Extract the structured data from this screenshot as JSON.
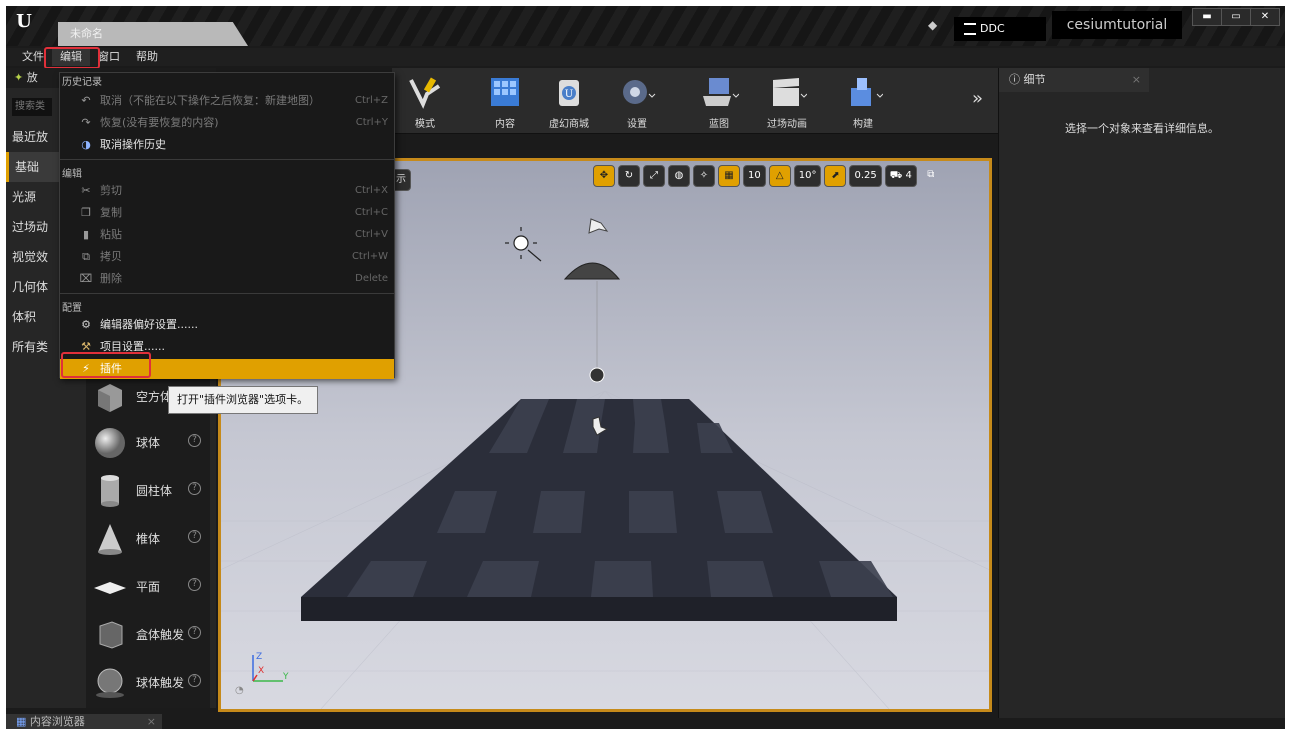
{
  "window": {
    "doc_tab": "未命名",
    "ddc_label": "DDC",
    "project_name": "cesiumtutorial",
    "window_buttons": [
      "▬",
      "▭",
      "✕"
    ]
  },
  "menubar": {
    "items": [
      "文件",
      "编辑",
      "窗口",
      "帮助"
    ]
  },
  "modes": {
    "header": "放",
    "search_placeholder": "搜索类",
    "categories": [
      "最近放",
      "基础",
      "光源",
      "过场动",
      "视觉效",
      "几何体",
      "体积",
      "所有类"
    ],
    "places": [
      {
        "label": "空方体",
        "icon": "cube-icon"
      },
      {
        "label": "球体",
        "icon": "sphere-icon"
      },
      {
        "label": "圆柱体",
        "icon": "cylinder-icon"
      },
      {
        "label": "椎体",
        "icon": "cone-icon"
      },
      {
        "label": "平面",
        "icon": "plane-icon"
      },
      {
        "label": "盒体触发",
        "icon": "box-trigger-icon"
      },
      {
        "label": "球体触发",
        "icon": "sphere-trigger-icon"
      }
    ],
    "help_glyph": "?"
  },
  "toolbar": {
    "items": [
      {
        "label": "模式",
        "icon": "modes-icon"
      },
      {
        "label": "内容",
        "icon": "content-icon"
      },
      {
        "label": "虚幻商城",
        "icon": "marketplace-icon"
      },
      {
        "label": "设置",
        "icon": "settings-icon"
      },
      {
        "label": "蓝图",
        "icon": "blueprint-icon"
      },
      {
        "label": "过场动画",
        "icon": "cinematics-icon"
      },
      {
        "label": "构建",
        "icon": "build-icon"
      }
    ],
    "more": "»"
  },
  "viewport": {
    "show_label": "示",
    "grid_snap": "10",
    "rotation_snap": "10°",
    "scale_snap": "0.25",
    "camera_speed": "4",
    "axis_z": "Z",
    "axis_x": "X",
    "axis_y": "Y"
  },
  "details": {
    "tab_label": "细节",
    "hint": "选择一个对象来查看详细信息。"
  },
  "content_browser": {
    "tab_label": "内容浏览器"
  },
  "edit_menu": {
    "sections": {
      "history": "历史记录",
      "edit": "编辑",
      "config": "配置"
    },
    "history_items": [
      {
        "label": "取消（不能在以下操作之后恢复：新建地图）",
        "shortcut": "Ctrl+Z",
        "disabled": true
      },
      {
        "label": "恢复(没有要恢复的内容)",
        "shortcut": "Ctrl+Y",
        "disabled": true
      },
      {
        "label": "取消操作历史",
        "shortcut": "",
        "disabled": false
      }
    ],
    "edit_items": [
      {
        "label": "剪切",
        "shortcut": "Ctrl+X"
      },
      {
        "label": "复制",
        "shortcut": "Ctrl+C"
      },
      {
        "label": "粘贴",
        "shortcut": "Ctrl+V"
      },
      {
        "label": "拷贝",
        "shortcut": "Ctrl+W"
      },
      {
        "label": "删除",
        "shortcut": "Delete"
      }
    ],
    "config_items": [
      {
        "label": "编辑器偏好设置......"
      },
      {
        "label": "项目设置......"
      },
      {
        "label": "插件",
        "highlighted": true
      }
    ],
    "tooltip": "打开\"插件浏览器\"选项卡。"
  },
  "colors": {
    "accent": "#e0a000",
    "highlight_box": "#e0303a",
    "viewport_border": "#c68a1a"
  }
}
